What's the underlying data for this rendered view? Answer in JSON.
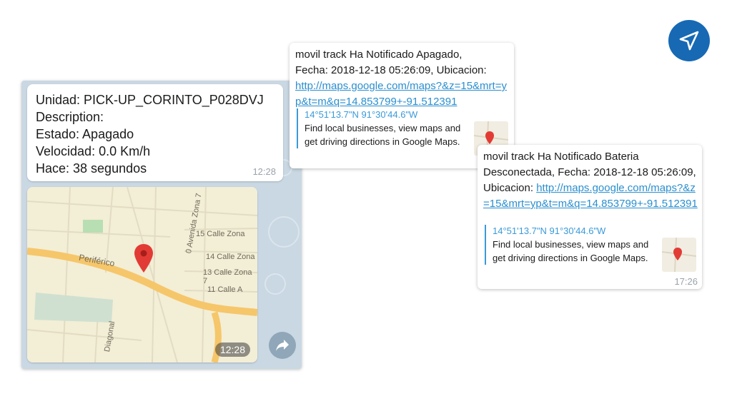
{
  "colors": {
    "accent": "#1769b4",
    "link": "#2a8fcf",
    "preview_title": "#3a9ad9",
    "chat_background": "#c9d8e3",
    "map_road": "#f6c66a"
  },
  "unit_message": {
    "lines": [
      "Unidad: PICK-UP_CORINTO_P028DVJ",
      "Description:",
      "Estado: Apagado",
      "Velocidad: 0.0 Km/h",
      "Hace: 38 segundos"
    ],
    "time": "12:28"
  },
  "map_message": {
    "time": "12:28",
    "labels": {
      "street1": "15 Calle Zona",
      "street2": "14 Calle Zona",
      "street3": "13 Calle Zona 7",
      "street4": "11 Calle A",
      "avenue": "0 Avenida Zona 7",
      "road": "Periférico",
      "diagonal": "Diagonal"
    },
    "pin_icon": "map-pin-icon"
  },
  "share_icon": "share-arrow-icon",
  "brand_icon": "paper-plane-icon",
  "notification_1": {
    "text_a": "movil track Ha Notificado  Apagado,",
    "text_b": "Fecha: 2018-12-18 05:26:09, Ubicacion:",
    "link": "http://maps.google.com/maps?&z=15&mrt=yp&t=m&q=14.853799+-91.512391",
    "preview_title": "14°51'13.7\"N 91°30'44.6\"W",
    "preview_desc": "Find local businesses, view maps and get driving directions in Google Maps."
  },
  "notification_2": {
    "text_a": "movil track Ha Notificado  Bateria Desconectada, Fecha: 2018-12-18 05:26:09, Ubicacion: ",
    "link": "http://maps.google.com/maps?&z=15&mrt=yp&t=m&q=14.853799+-91.512391",
    "preview_title": "14°51'13.7\"N 91°30'44.6\"W",
    "preview_desc": "Find local businesses, view maps and get driving directions in Google Maps.",
    "time": "17:26"
  }
}
